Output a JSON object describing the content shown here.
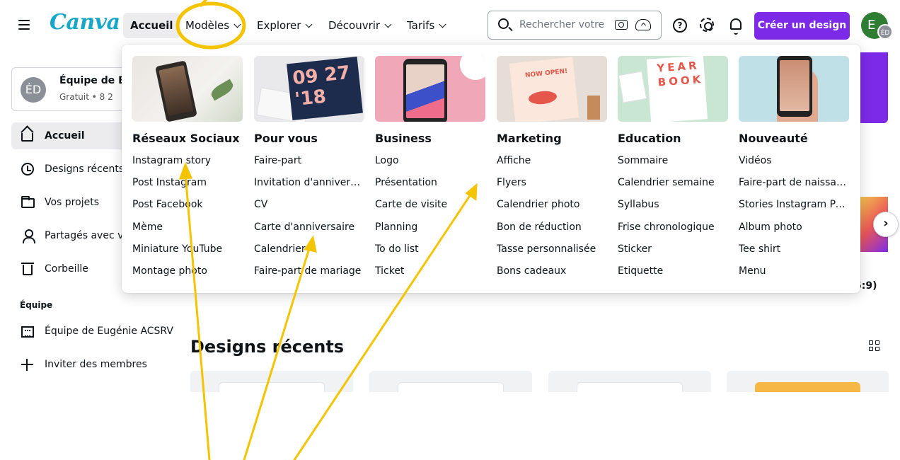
{
  "header": {
    "logo_text": "Canva",
    "nav": [
      {
        "label": "Accueil"
      },
      {
        "label": "Modèles"
      },
      {
        "label": "Explorer"
      },
      {
        "label": "Découvrir"
      },
      {
        "label": "Tarifs"
      }
    ],
    "search_placeholder": "Rechercher votre",
    "help_icon": "question-icon",
    "settings_icon": "gear-icon",
    "notifications_icon": "bell-icon",
    "create_button": "Créer un design",
    "avatar_initial": "E",
    "avatar_badge": "ÉD"
  },
  "sidebar": {
    "team": {
      "initials": "ÉD",
      "name": "Équipe de Eug",
      "subtitle": "Gratuit • 8 2"
    },
    "items": [
      {
        "label": "Accueil",
        "icon": "home-icon",
        "active": true
      },
      {
        "label": "Designs récents",
        "icon": "clock-icon"
      },
      {
        "label": "Vos projets",
        "icon": "folder-icon"
      },
      {
        "label": "Partagés avec vo",
        "icon": "people-icon"
      },
      {
        "label": "Corbeille",
        "icon": "trash-icon"
      }
    ],
    "section_label": "Équipe",
    "team_items": [
      {
        "label": "Équipe de Eugénie ACSRV",
        "icon": "building-icon"
      },
      {
        "label": "Inviter des membres",
        "icon": "plus-icon"
      }
    ]
  },
  "main": {
    "partial_label": "6:9)",
    "recent_title": "Designs récents"
  },
  "dropdown": {
    "columns": [
      {
        "title": "Réseaux Sociaux",
        "items": [
          "Instagram story",
          "Post Instagram",
          "Post Facebook",
          "Mème",
          "Miniature YouTube",
          "Montage photo"
        ]
      },
      {
        "title": "Pour vous",
        "items": [
          "Faire-part",
          "Invitation d'anniversaire",
          "CV",
          "Carte d'anniversaire",
          "Calendrier",
          "Faire-part de mariage"
        ]
      },
      {
        "title": "Business",
        "items": [
          "Logo",
          "Présentation",
          "Carte de visite",
          "Planning",
          "To do list",
          "Ticket"
        ]
      },
      {
        "title": "Marketing",
        "items": [
          "Affiche",
          "Flyers",
          "Calendrier photo",
          "Bon de réduction",
          "Tasse personnalisée",
          "Bons cadeaux"
        ]
      },
      {
        "title": "Education",
        "items": [
          "Sommaire",
          "Calendrier semaine",
          "Syllabus",
          "Frise chronologique",
          "Sticker",
          "Etiquette"
        ]
      },
      {
        "title": "Nouveauté",
        "items": [
          "Vidéos",
          "Faire-part de naissance",
          "Stories Instagram Post",
          "Album photo",
          "Tee shirt",
          "Menu"
        ]
      }
    ],
    "thumb_texts": {
      "pour_vous": "09 27 '18",
      "marketing": "NOW OPEN!",
      "education": "YEAR BOOK"
    }
  },
  "colors": {
    "brand": "#7d2ae8",
    "logo": "#19a7c9",
    "annotation": "#f5c400"
  }
}
